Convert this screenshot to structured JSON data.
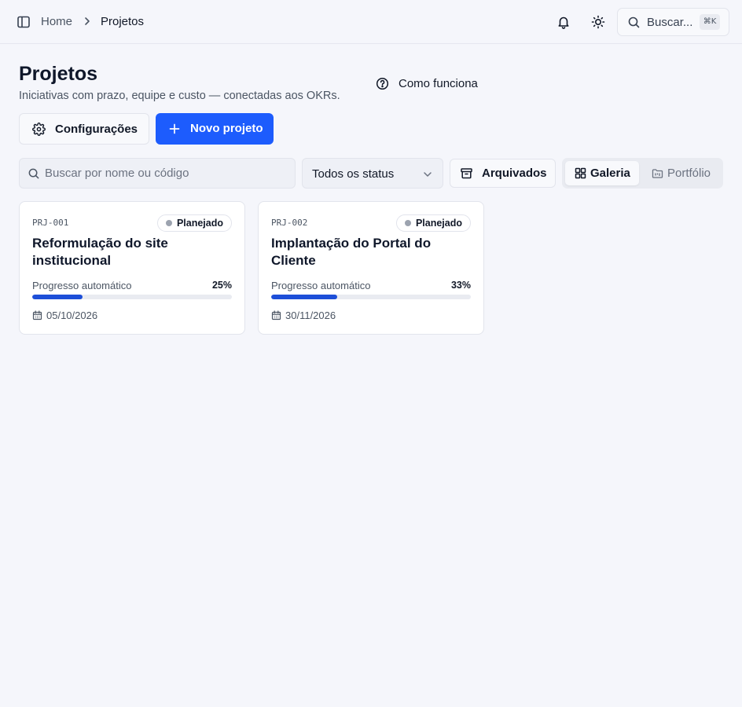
{
  "breadcrumb": {
    "home": "Home",
    "current": "Projetos"
  },
  "topbar": {
    "search_label": "Buscar...",
    "search_shortcut": "⌘K"
  },
  "header": {
    "title": "Projetos",
    "subtitle": "Iniciativas com prazo, equipe e custo — conectadas aos OKRs.",
    "help_link": "Como funciona"
  },
  "actions": {
    "settings_label": "Configurações",
    "new_project_label": "Novo projeto"
  },
  "filters": {
    "search_placeholder": "Buscar por nome ou código",
    "status_selected": "Todos os status",
    "archived_label": "Arquivados"
  },
  "views": {
    "gallery": "Galeria",
    "portfolio": "Portfólio",
    "active": "gallery"
  },
  "colors": {
    "primary": "#1d5cfd",
    "progress": "#1d4fd8",
    "status_planned": "#9ca3af"
  },
  "projects": [
    {
      "code": "PRJ-001",
      "status": "Planejado",
      "title": "Reformulação do site institucional",
      "progress_label": "Progresso automático",
      "progress_pct": 25,
      "progress_text": "25%",
      "date": "05/10/2026"
    },
    {
      "code": "PRJ-002",
      "status": "Planejado",
      "title": "Implantação do Portal do Cliente",
      "progress_label": "Progresso automático",
      "progress_pct": 33,
      "progress_text": "33%",
      "date": "30/11/2026"
    }
  ]
}
